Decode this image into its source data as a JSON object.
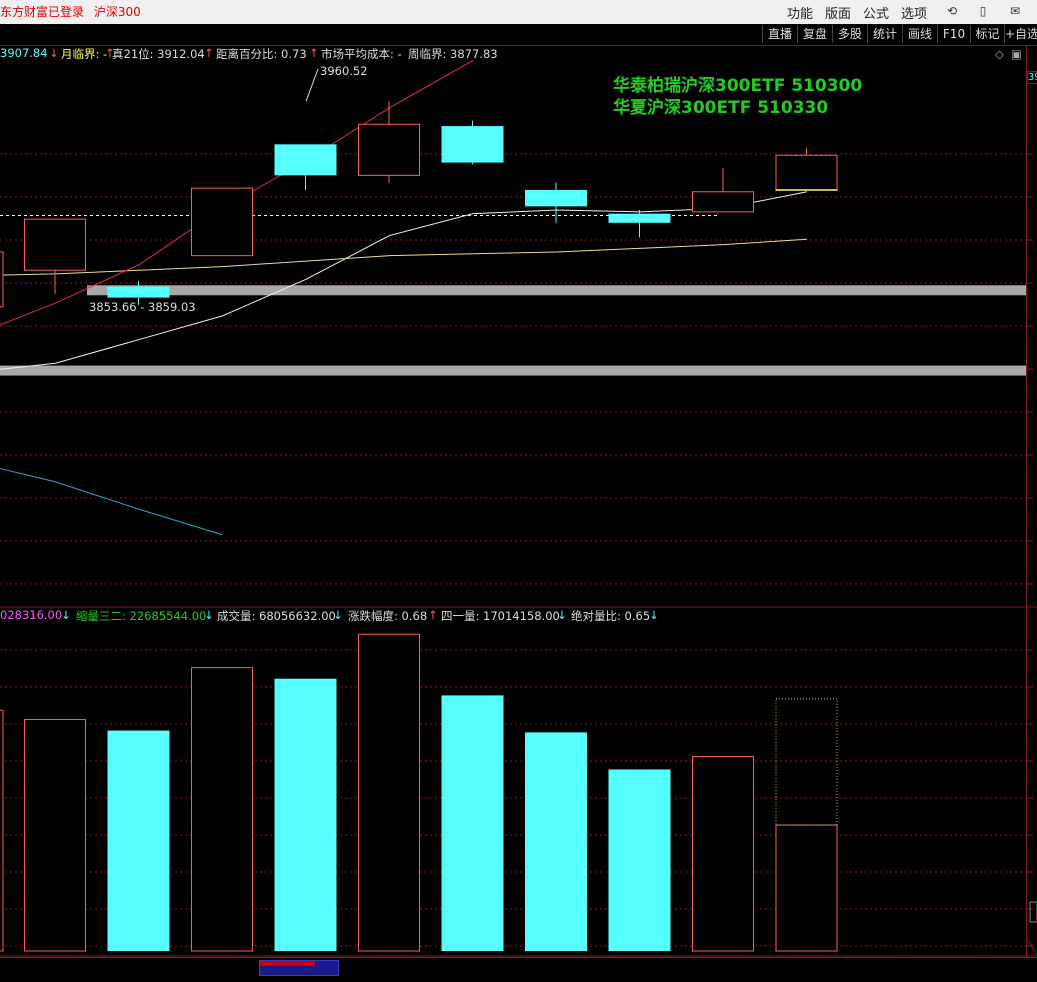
{
  "window": {
    "app_status": "东方财富已登录",
    "instrument": "沪深300"
  },
  "menu": [
    "功能",
    "版面",
    "公式",
    "选项"
  ],
  "toolbar": [
    "直播",
    "复盘",
    "多股",
    "统计",
    "画线",
    "F10",
    "标记",
    "+自选"
  ],
  "price_info": {
    "value0": "3907.84",
    "item1_label": "月临界: -",
    "item2": "真21位: 3912.04",
    "item3": "距离百分比: 0.73",
    "item4": "市场平均成本: -",
    "item5": "周临界: 3877.83"
  },
  "annotations": {
    "high_label": "3960.52",
    "range_label": "3853.66 - 3859.03",
    "right_edge_label": "39"
  },
  "etf_notes": [
    "华泰柏瑞沪深300ETF 510300",
    "华夏沪深300ETF 510330"
  ],
  "volume_info": {
    "value0": "028316.00",
    "item1": "缩量三二: 22685544.00",
    "item2": "成交量: 68056632.00",
    "item3": "涨跌幅度: 0.68",
    "item4": "四一量: 17014158.00",
    "item5": "绝对量比: 0.65"
  },
  "colors": {
    "up": "#ff5c5c",
    "down": "#55ffff",
    "grid": "#8b1a1a",
    "text_white": "#dddddd",
    "text_yellow": "#ffff55",
    "text_green": "#22cc22",
    "text_magenta": "#ff55ff"
  },
  "chart_data": {
    "type": "candlestick",
    "candles": [
      {
        "open": 3868,
        "close": 3896,
        "high": 3896,
        "low": 3855,
        "dir": "up"
      },
      {
        "open": 3859,
        "close": 3853,
        "high": 3862,
        "low": 3849,
        "dir": "down"
      },
      {
        "open": 3876,
        "close": 3913,
        "high": 3913,
        "low": 3876,
        "dir": "up"
      },
      {
        "open": 3937,
        "close": 3920,
        "high": 3937,
        "low": 3912,
        "dir": "down"
      },
      {
        "open": 3920,
        "close": 3948,
        "high": 3960.52,
        "low": 3916,
        "dir": "up"
      },
      {
        "open": 3947,
        "close": 3927,
        "high": 3950,
        "low": 3926,
        "dir": "down"
      },
      {
        "open": 3912,
        "close": 3903,
        "high": 3916,
        "low": 3894,
        "dir": "down"
      },
      {
        "open": 3899,
        "close": 3894,
        "high": 3901,
        "low": 3886,
        "dir": "down"
      },
      {
        "open": 3900,
        "close": 3911,
        "high": 3924,
        "low": 3900,
        "dir": "up"
      },
      {
        "open": 3912,
        "close": 3931,
        "high": 3935,
        "low": 3912,
        "dir": "up"
      }
    ],
    "volumes": [
      {
        "value": 62500000,
        "dir": "up"
      },
      {
        "value": 59500000,
        "dir": "down"
      },
      {
        "value": 76500000,
        "dir": "up"
      },
      {
        "value": 73500000,
        "dir": "down"
      },
      {
        "value": 85500000,
        "dir": "up"
      },
      {
        "value": 69000000,
        "dir": "down"
      },
      {
        "value": 59000000,
        "dir": "down"
      },
      {
        "value": 49000000,
        "dir": "down"
      },
      {
        "value": 52500000,
        "dir": "up"
      },
      {
        "value": 34000000,
        "dir": "up",
        "projected": 68056632
      }
    ],
    "volume_max": 88000000,
    "price_range": [
      3690,
      3975
    ],
    "support_bands": [
      3857,
      3813
    ],
    "dashed_level": 3898,
    "ma_white": [
      3812,
      3817,
      3830,
      3843,
      3863,
      3887,
      3899,
      3901,
      3900,
      3902,
      3911
    ],
    "ma_yellow": [
      3865,
      3866,
      3868,
      3870,
      3873,
      3876,
      3877,
      3878,
      3880,
      3882,
      3885
    ],
    "ma_red": [
      3832,
      3850,
      3871,
      3902,
      3928,
      3957,
      3983
    ],
    "ma_cyan": [
      3763,
      3752,
      3737,
      3723
    ]
  }
}
